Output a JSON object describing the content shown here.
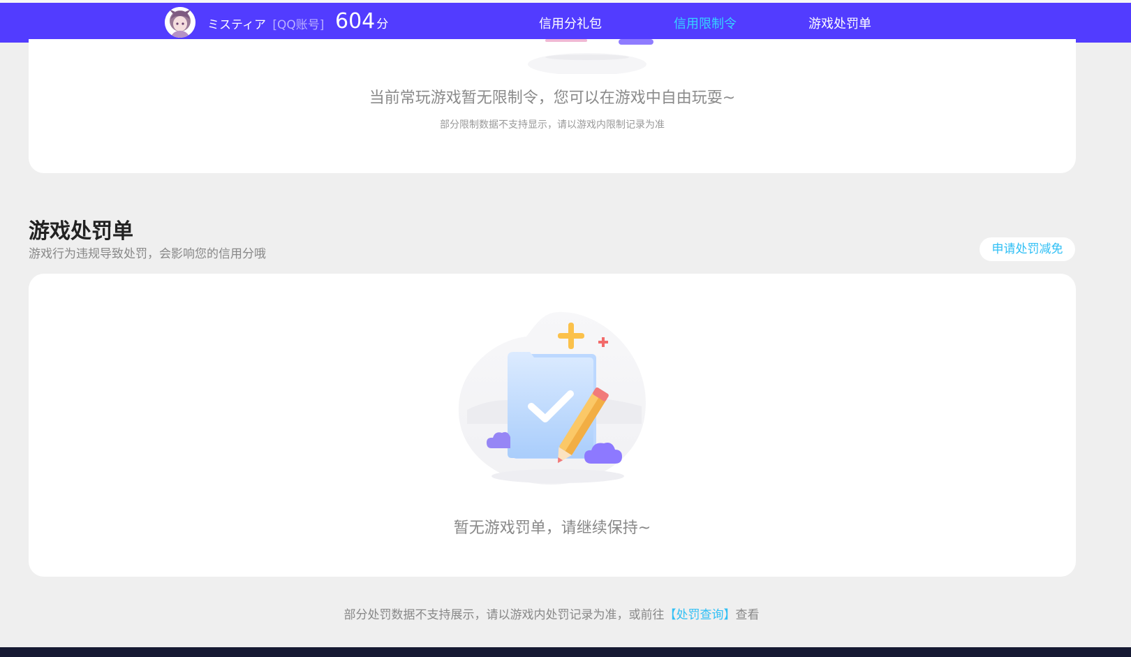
{
  "header": {
    "user_name": "ミスティア",
    "account_tag": "[QQ账号]",
    "score": "604",
    "score_unit": "分",
    "nav": [
      {
        "label": "信用分礼包"
      },
      {
        "label": "信用限制令"
      },
      {
        "label": "游戏处罚单"
      }
    ],
    "active_nav": "信用限制令"
  },
  "restriction_card": {
    "title": "当前常玩游戏暂无限制令，您可以在游戏中自由玩耍~",
    "subtitle": "部分限制数据不支持显示，请以游戏内限制记录为准"
  },
  "penalty_section": {
    "title": "游戏处罚单",
    "subtitle": "游戏行为违规导致处罚，会影响您的信用分哦",
    "apply_button": "申请处罚减免",
    "empty_message": "暂无游戏罚单，请继续保持~"
  },
  "footer": {
    "note_prefix": "部分处罚数据不支持展示，请以游戏内处罚记录为准，或前往",
    "link_label": "【处罚查询】",
    "note_suffix": "查看"
  },
  "colors": {
    "brand": "#523cff",
    "accent": "#35d4ff",
    "link": "#2fbff5"
  }
}
